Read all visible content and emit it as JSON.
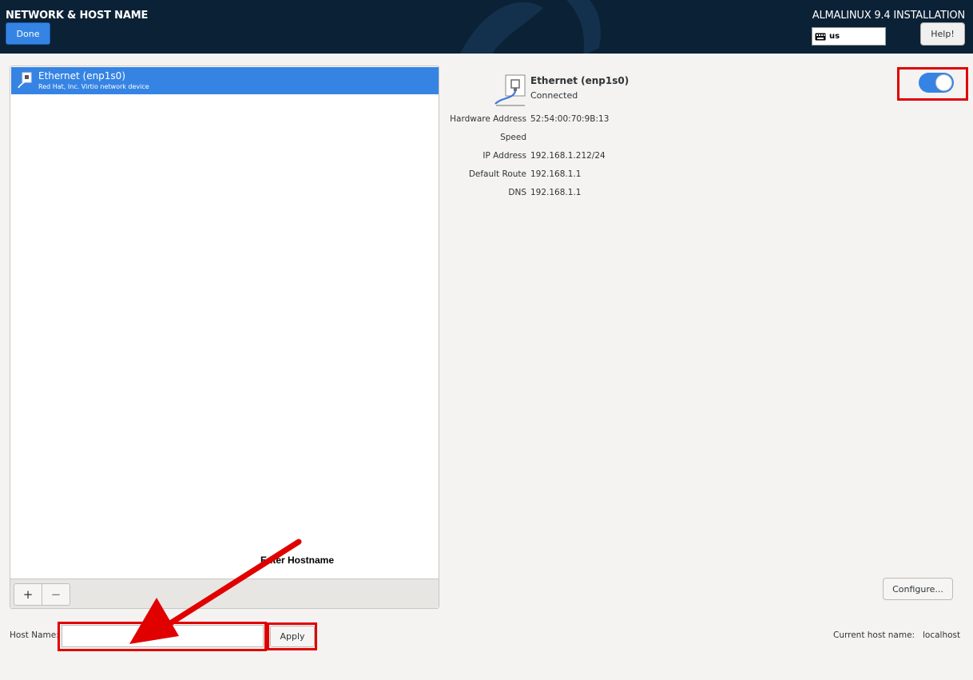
{
  "header": {
    "page_title": "NETWORK & HOST NAME",
    "done_label": "Done",
    "install_title": "ALMALINUX 9.4 INSTALLATION",
    "keyboard_layout": "us",
    "help_label": "Help!"
  },
  "device_list": {
    "items": [
      {
        "name": "Ethernet (enp1s0)",
        "description": "Red Hat, Inc. Virtio network device",
        "selected": true
      }
    ],
    "add_label": "+",
    "remove_label": "−"
  },
  "details": {
    "device_name": "Ethernet (enp1s0)",
    "status": "Connected",
    "enabled": true,
    "fields": [
      {
        "label": "Hardware Address",
        "value": "52:54:00:70:9B:13"
      },
      {
        "label": "Speed",
        "value": ""
      },
      {
        "label": "IP Address",
        "value": "192.168.1.212/24"
      },
      {
        "label": "Default Route",
        "value": "192.168.1.1"
      },
      {
        "label": "DNS",
        "value": "192.168.1.1"
      }
    ],
    "configure_label": "Configure..."
  },
  "hostname": {
    "label": "Host Name:",
    "value": "",
    "apply_label": "Apply",
    "current_label": "Current host name:",
    "current_value": "localhost"
  },
  "annotation": {
    "text": "Enter Hostname",
    "color": "#e00000"
  },
  "colors": {
    "header_bg": "#0b2135",
    "accent": "#3584e4",
    "highlight": "#e00000"
  }
}
